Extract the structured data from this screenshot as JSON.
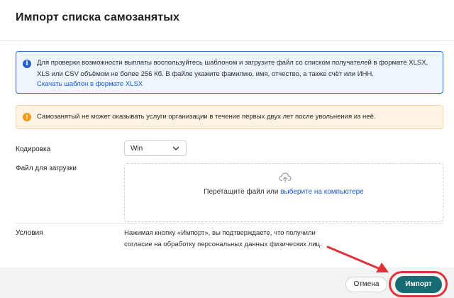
{
  "dialog": {
    "title": "Импорт списка самозанятых"
  },
  "info": {
    "icon": "info-icon",
    "text": "Для проверки возможности выплаты воспользуйтесь шаблоном и загрузите файл со списком получателей в формате XLSX, XLS или CSV объёмом не более 256 Кб. В файле укажите фамилию, имя, отчество, а также счёт или ИНН.",
    "link": "Скачать шаблон в формате XLSX",
    "accent": "#2f6fd6"
  },
  "warning": {
    "icon": "warning-icon",
    "text": "Самозанятый не может оказывать услуги организации в течение первых двух лет после увольнения из неё.",
    "accent": "#ef9a1a"
  },
  "form": {
    "encoding_label": "Кодировка",
    "encoding_value": "Win",
    "file_label": "Файл для загрузки",
    "dropzone_text": "Перетащите файл или",
    "dropzone_link": "выберите на компьютере",
    "terms_label": "Условия",
    "terms_text": "Нажимая кнопку «Импорт», вы подтверждаете, что получили согласие на обработку персональных данных физических лиц."
  },
  "footer": {
    "cancel_label": "Отмена",
    "import_label": "Импорт",
    "primary_color": "#176b73",
    "highlight_color": "#e0323a"
  }
}
